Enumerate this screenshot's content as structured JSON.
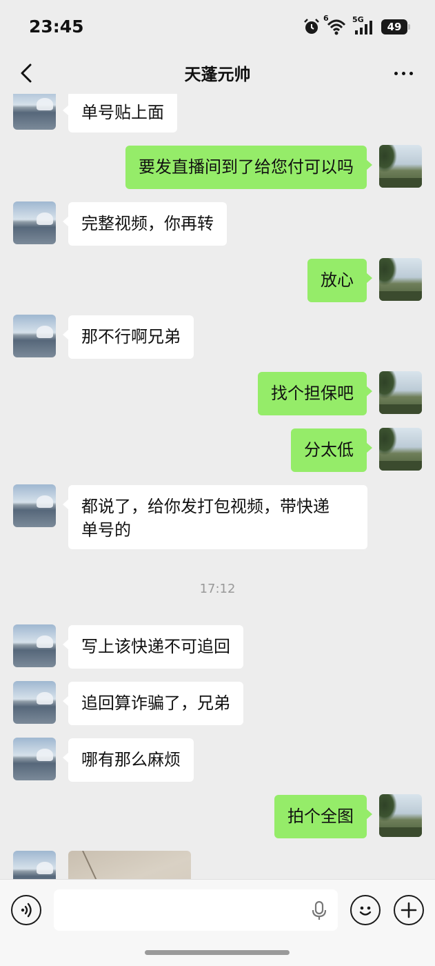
{
  "status_bar": {
    "time": "23:45",
    "network": "5G",
    "wifi_label": "6",
    "battery": "49",
    "icons": [
      "alarm-icon",
      "wifi-icon",
      "signal-icon",
      "battery-icon"
    ]
  },
  "header": {
    "title": "天蓬元帅",
    "back_icon": "chevron-left-icon",
    "more_icon": "more-dots-icon"
  },
  "messages": [
    {
      "sender": "them",
      "text": "单号贴上面"
    },
    {
      "sender": "me",
      "text": "要发直播间到了给您付可以吗"
    },
    {
      "sender": "them",
      "text": "完整视频，你再转"
    },
    {
      "sender": "me",
      "text": "放心"
    },
    {
      "sender": "them",
      "text": "那不行啊兄弟"
    },
    {
      "sender": "me",
      "text": "找个担保吧"
    },
    {
      "sender": "me",
      "text": "分太低"
    },
    {
      "sender": "them",
      "text_line1": "都说了，给你发打包视频，带快递",
      "text_line2": "单号的"
    },
    {
      "type": "timestamp",
      "text": "17:12"
    },
    {
      "sender": "them",
      "text": "写上该快递不可追回"
    },
    {
      "sender": "them",
      "text": "追回算诈骗了，兄弟"
    },
    {
      "sender": "them",
      "text": "哪有那么麻烦"
    },
    {
      "sender": "me",
      "text": "拍个全图"
    },
    {
      "sender": "them",
      "type": "image"
    }
  ],
  "input_bar": {
    "placeholder": "",
    "voice_icon": "voice-icon",
    "mic_icon": "microphone-icon",
    "emoji_icon": "emoji-icon",
    "plus_icon": "plus-icon"
  },
  "colors": {
    "background": "#ededed",
    "bubble_me": "#95ec69",
    "bubble_them": "#ffffff"
  }
}
